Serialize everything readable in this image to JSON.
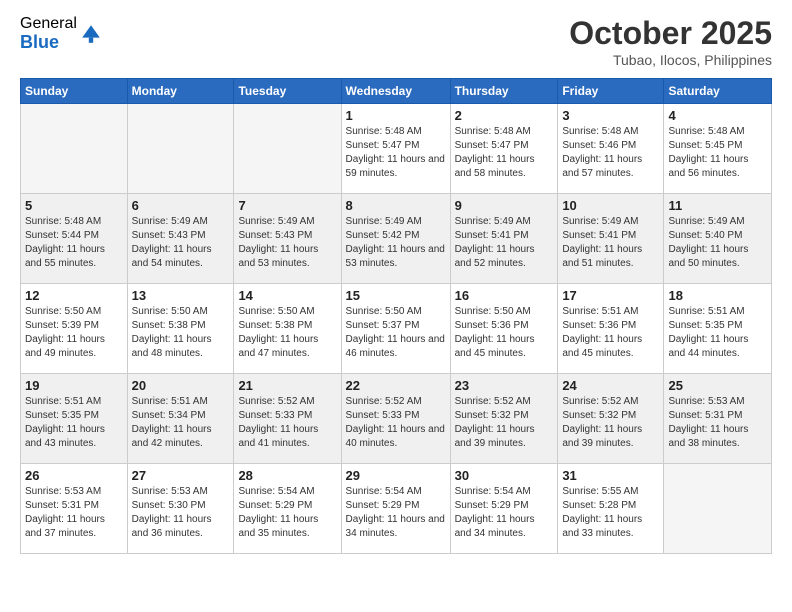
{
  "logo": {
    "general": "General",
    "blue": "Blue"
  },
  "title": "October 2025",
  "location": "Tubao, Ilocos, Philippines",
  "days_of_week": [
    "Sunday",
    "Monday",
    "Tuesday",
    "Wednesday",
    "Thursday",
    "Friday",
    "Saturday"
  ],
  "weeks": [
    {
      "shaded": false,
      "days": [
        {
          "num": "",
          "sunrise": "",
          "sunset": "",
          "daylight": "",
          "empty": true
        },
        {
          "num": "",
          "sunrise": "",
          "sunset": "",
          "daylight": "",
          "empty": true
        },
        {
          "num": "",
          "sunrise": "",
          "sunset": "",
          "daylight": "",
          "empty": true
        },
        {
          "num": "1",
          "sunrise": "Sunrise: 5:48 AM",
          "sunset": "Sunset: 5:47 PM",
          "daylight": "Daylight: 11 hours and 59 minutes.",
          "empty": false
        },
        {
          "num": "2",
          "sunrise": "Sunrise: 5:48 AM",
          "sunset": "Sunset: 5:47 PM",
          "daylight": "Daylight: 11 hours and 58 minutes.",
          "empty": false
        },
        {
          "num": "3",
          "sunrise": "Sunrise: 5:48 AM",
          "sunset": "Sunset: 5:46 PM",
          "daylight": "Daylight: 11 hours and 57 minutes.",
          "empty": false
        },
        {
          "num": "4",
          "sunrise": "Sunrise: 5:48 AM",
          "sunset": "Sunset: 5:45 PM",
          "daylight": "Daylight: 11 hours and 56 minutes.",
          "empty": false
        }
      ]
    },
    {
      "shaded": true,
      "days": [
        {
          "num": "5",
          "sunrise": "Sunrise: 5:48 AM",
          "sunset": "Sunset: 5:44 PM",
          "daylight": "Daylight: 11 hours and 55 minutes.",
          "empty": false
        },
        {
          "num": "6",
          "sunrise": "Sunrise: 5:49 AM",
          "sunset": "Sunset: 5:43 PM",
          "daylight": "Daylight: 11 hours and 54 minutes.",
          "empty": false
        },
        {
          "num": "7",
          "sunrise": "Sunrise: 5:49 AM",
          "sunset": "Sunset: 5:43 PM",
          "daylight": "Daylight: 11 hours and 53 minutes.",
          "empty": false
        },
        {
          "num": "8",
          "sunrise": "Sunrise: 5:49 AM",
          "sunset": "Sunset: 5:42 PM",
          "daylight": "Daylight: 11 hours and 53 minutes.",
          "empty": false
        },
        {
          "num": "9",
          "sunrise": "Sunrise: 5:49 AM",
          "sunset": "Sunset: 5:41 PM",
          "daylight": "Daylight: 11 hours and 52 minutes.",
          "empty": false
        },
        {
          "num": "10",
          "sunrise": "Sunrise: 5:49 AM",
          "sunset": "Sunset: 5:41 PM",
          "daylight": "Daylight: 11 hours and 51 minutes.",
          "empty": false
        },
        {
          "num": "11",
          "sunrise": "Sunrise: 5:49 AM",
          "sunset": "Sunset: 5:40 PM",
          "daylight": "Daylight: 11 hours and 50 minutes.",
          "empty": false
        }
      ]
    },
    {
      "shaded": false,
      "days": [
        {
          "num": "12",
          "sunrise": "Sunrise: 5:50 AM",
          "sunset": "Sunset: 5:39 PM",
          "daylight": "Daylight: 11 hours and 49 minutes.",
          "empty": false
        },
        {
          "num": "13",
          "sunrise": "Sunrise: 5:50 AM",
          "sunset": "Sunset: 5:38 PM",
          "daylight": "Daylight: 11 hours and 48 minutes.",
          "empty": false
        },
        {
          "num": "14",
          "sunrise": "Sunrise: 5:50 AM",
          "sunset": "Sunset: 5:38 PM",
          "daylight": "Daylight: 11 hours and 47 minutes.",
          "empty": false
        },
        {
          "num": "15",
          "sunrise": "Sunrise: 5:50 AM",
          "sunset": "Sunset: 5:37 PM",
          "daylight": "Daylight: 11 hours and 46 minutes.",
          "empty": false
        },
        {
          "num": "16",
          "sunrise": "Sunrise: 5:50 AM",
          "sunset": "Sunset: 5:36 PM",
          "daylight": "Daylight: 11 hours and 45 minutes.",
          "empty": false
        },
        {
          "num": "17",
          "sunrise": "Sunrise: 5:51 AM",
          "sunset": "Sunset: 5:36 PM",
          "daylight": "Daylight: 11 hours and 45 minutes.",
          "empty": false
        },
        {
          "num": "18",
          "sunrise": "Sunrise: 5:51 AM",
          "sunset": "Sunset: 5:35 PM",
          "daylight": "Daylight: 11 hours and 44 minutes.",
          "empty": false
        }
      ]
    },
    {
      "shaded": true,
      "days": [
        {
          "num": "19",
          "sunrise": "Sunrise: 5:51 AM",
          "sunset": "Sunset: 5:35 PM",
          "daylight": "Daylight: 11 hours and 43 minutes.",
          "empty": false
        },
        {
          "num": "20",
          "sunrise": "Sunrise: 5:51 AM",
          "sunset": "Sunset: 5:34 PM",
          "daylight": "Daylight: 11 hours and 42 minutes.",
          "empty": false
        },
        {
          "num": "21",
          "sunrise": "Sunrise: 5:52 AM",
          "sunset": "Sunset: 5:33 PM",
          "daylight": "Daylight: 11 hours and 41 minutes.",
          "empty": false
        },
        {
          "num": "22",
          "sunrise": "Sunrise: 5:52 AM",
          "sunset": "Sunset: 5:33 PM",
          "daylight": "Daylight: 11 hours and 40 minutes.",
          "empty": false
        },
        {
          "num": "23",
          "sunrise": "Sunrise: 5:52 AM",
          "sunset": "Sunset: 5:32 PM",
          "daylight": "Daylight: 11 hours and 39 minutes.",
          "empty": false
        },
        {
          "num": "24",
          "sunrise": "Sunrise: 5:52 AM",
          "sunset": "Sunset: 5:32 PM",
          "daylight": "Daylight: 11 hours and 39 minutes.",
          "empty": false
        },
        {
          "num": "25",
          "sunrise": "Sunrise: 5:53 AM",
          "sunset": "Sunset: 5:31 PM",
          "daylight": "Daylight: 11 hours and 38 minutes.",
          "empty": false
        }
      ]
    },
    {
      "shaded": false,
      "days": [
        {
          "num": "26",
          "sunrise": "Sunrise: 5:53 AM",
          "sunset": "Sunset: 5:31 PM",
          "daylight": "Daylight: 11 hours and 37 minutes.",
          "empty": false
        },
        {
          "num": "27",
          "sunrise": "Sunrise: 5:53 AM",
          "sunset": "Sunset: 5:30 PM",
          "daylight": "Daylight: 11 hours and 36 minutes.",
          "empty": false
        },
        {
          "num": "28",
          "sunrise": "Sunrise: 5:54 AM",
          "sunset": "Sunset: 5:29 PM",
          "daylight": "Daylight: 11 hours and 35 minutes.",
          "empty": false
        },
        {
          "num": "29",
          "sunrise": "Sunrise: 5:54 AM",
          "sunset": "Sunset: 5:29 PM",
          "daylight": "Daylight: 11 hours and 34 minutes.",
          "empty": false
        },
        {
          "num": "30",
          "sunrise": "Sunrise: 5:54 AM",
          "sunset": "Sunset: 5:29 PM",
          "daylight": "Daylight: 11 hours and 34 minutes.",
          "empty": false
        },
        {
          "num": "31",
          "sunrise": "Sunrise: 5:55 AM",
          "sunset": "Sunset: 5:28 PM",
          "daylight": "Daylight: 11 hours and 33 minutes.",
          "empty": false
        },
        {
          "num": "",
          "sunrise": "",
          "sunset": "",
          "daylight": "",
          "empty": true
        }
      ]
    }
  ]
}
